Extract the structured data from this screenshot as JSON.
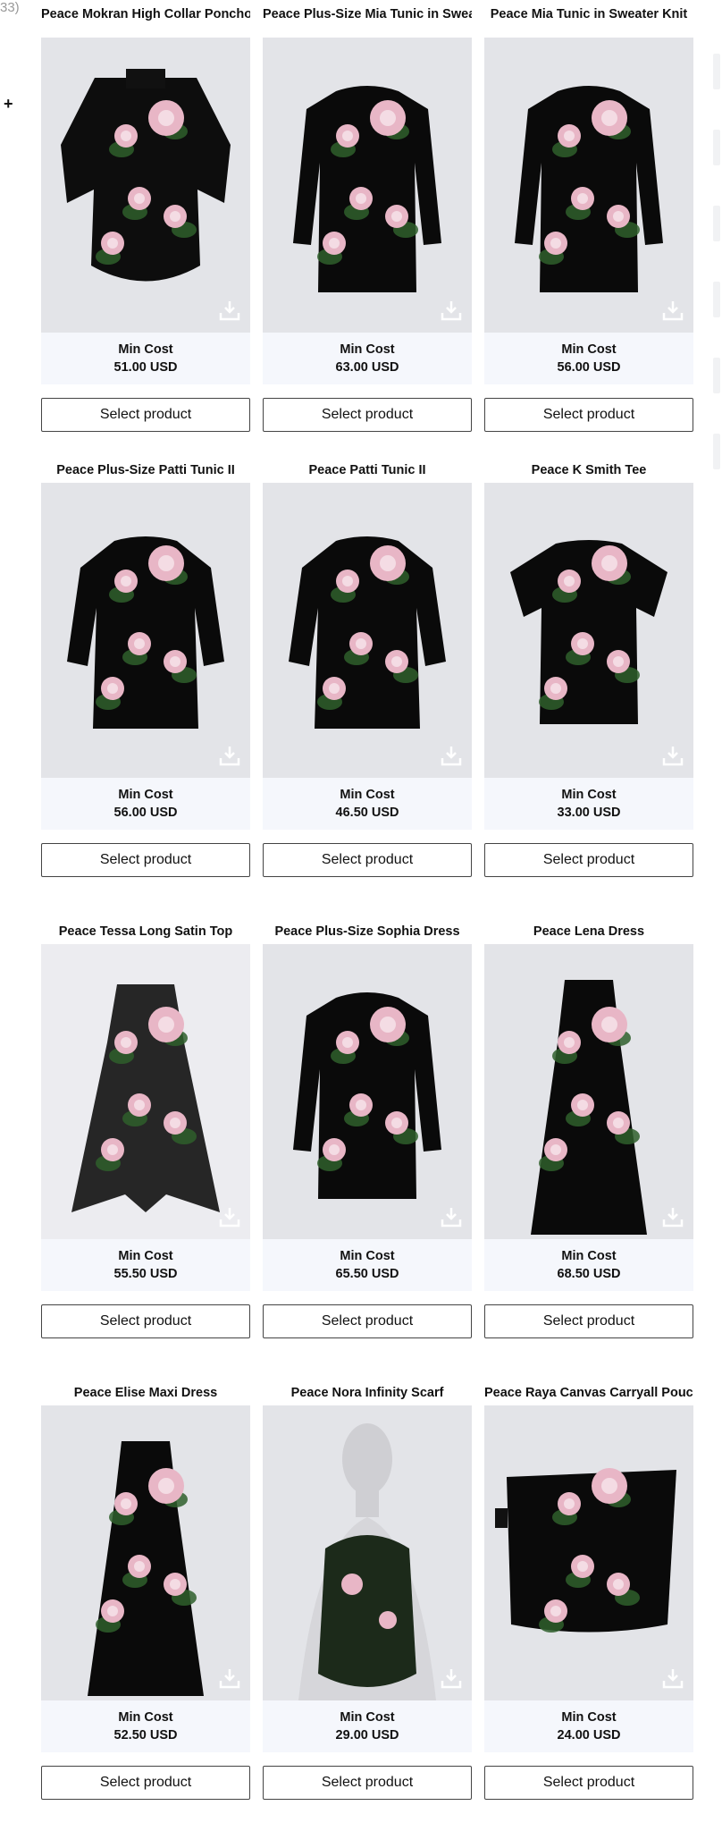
{
  "left_edge_text": "33)",
  "plus_label": "+",
  "colors": {
    "accent_black": "#000000",
    "rose_pink": "#e8b6c6",
    "leaf_green": "#2f5f2c",
    "image_bg": "#e3e4e8",
    "price_bg": "#f5f7fc"
  },
  "products": [
    {
      "title": "Peace Mokran High Collar Poncho",
      "min_cost_label": "Min Cost",
      "price": "51.00 USD",
      "button_label": "Select product",
      "garment": "poncho"
    },
    {
      "title": "Peace Plus-Size Mia Tunic in Sweater Knit",
      "min_cost_label": "Min Cost",
      "price": "63.00 USD",
      "button_label": "Select product",
      "garment": "tunic-long"
    },
    {
      "title": "Peace Mia Tunic in Sweater Knit",
      "min_cost_label": "Min Cost",
      "price": "56.00 USD",
      "button_label": "Select product",
      "garment": "tunic-long"
    },
    {
      "title": "Peace Plus-Size Patti Tunic II",
      "min_cost_label": "Min Cost",
      "price": "56.00 USD",
      "button_label": "Select product",
      "garment": "tunic"
    },
    {
      "title": "Peace Patti Tunic II",
      "min_cost_label": "Min Cost",
      "price": "46.50 USD",
      "button_label": "Select product",
      "garment": "tunic"
    },
    {
      "title": "Peace K Smith Tee",
      "min_cost_label": "Min Cost",
      "price": "33.00 USD",
      "button_label": "Select product",
      "garment": "tee"
    },
    {
      "title": "Peace Tessa Long Satin Top",
      "min_cost_label": "Min Cost",
      "price": "55.50 USD",
      "button_label": "Select product",
      "garment": "satin-top"
    },
    {
      "title": "Peace Plus-Size Sophia Dress",
      "min_cost_label": "Min Cost",
      "price": "65.50 USD",
      "button_label": "Select product",
      "garment": "tunic-long"
    },
    {
      "title": "Peace Lena Dress",
      "min_cost_label": "Min Cost",
      "price": "68.50 USD",
      "button_label": "Select product",
      "garment": "maxi"
    },
    {
      "title": "Peace Elise Maxi Dress",
      "min_cost_label": "Min Cost",
      "price": "52.50 USD",
      "button_label": "Select product",
      "garment": "maxi"
    },
    {
      "title": "Peace Nora Infinity Scarf",
      "min_cost_label": "Min Cost",
      "price": "29.00 USD",
      "button_label": "Select product",
      "garment": "scarf"
    },
    {
      "title": "Peace Raya Canvas Carryall Pouch",
      "min_cost_label": "Min Cost",
      "price": "24.00 USD",
      "button_label": "Select product",
      "garment": "pouch"
    }
  ]
}
